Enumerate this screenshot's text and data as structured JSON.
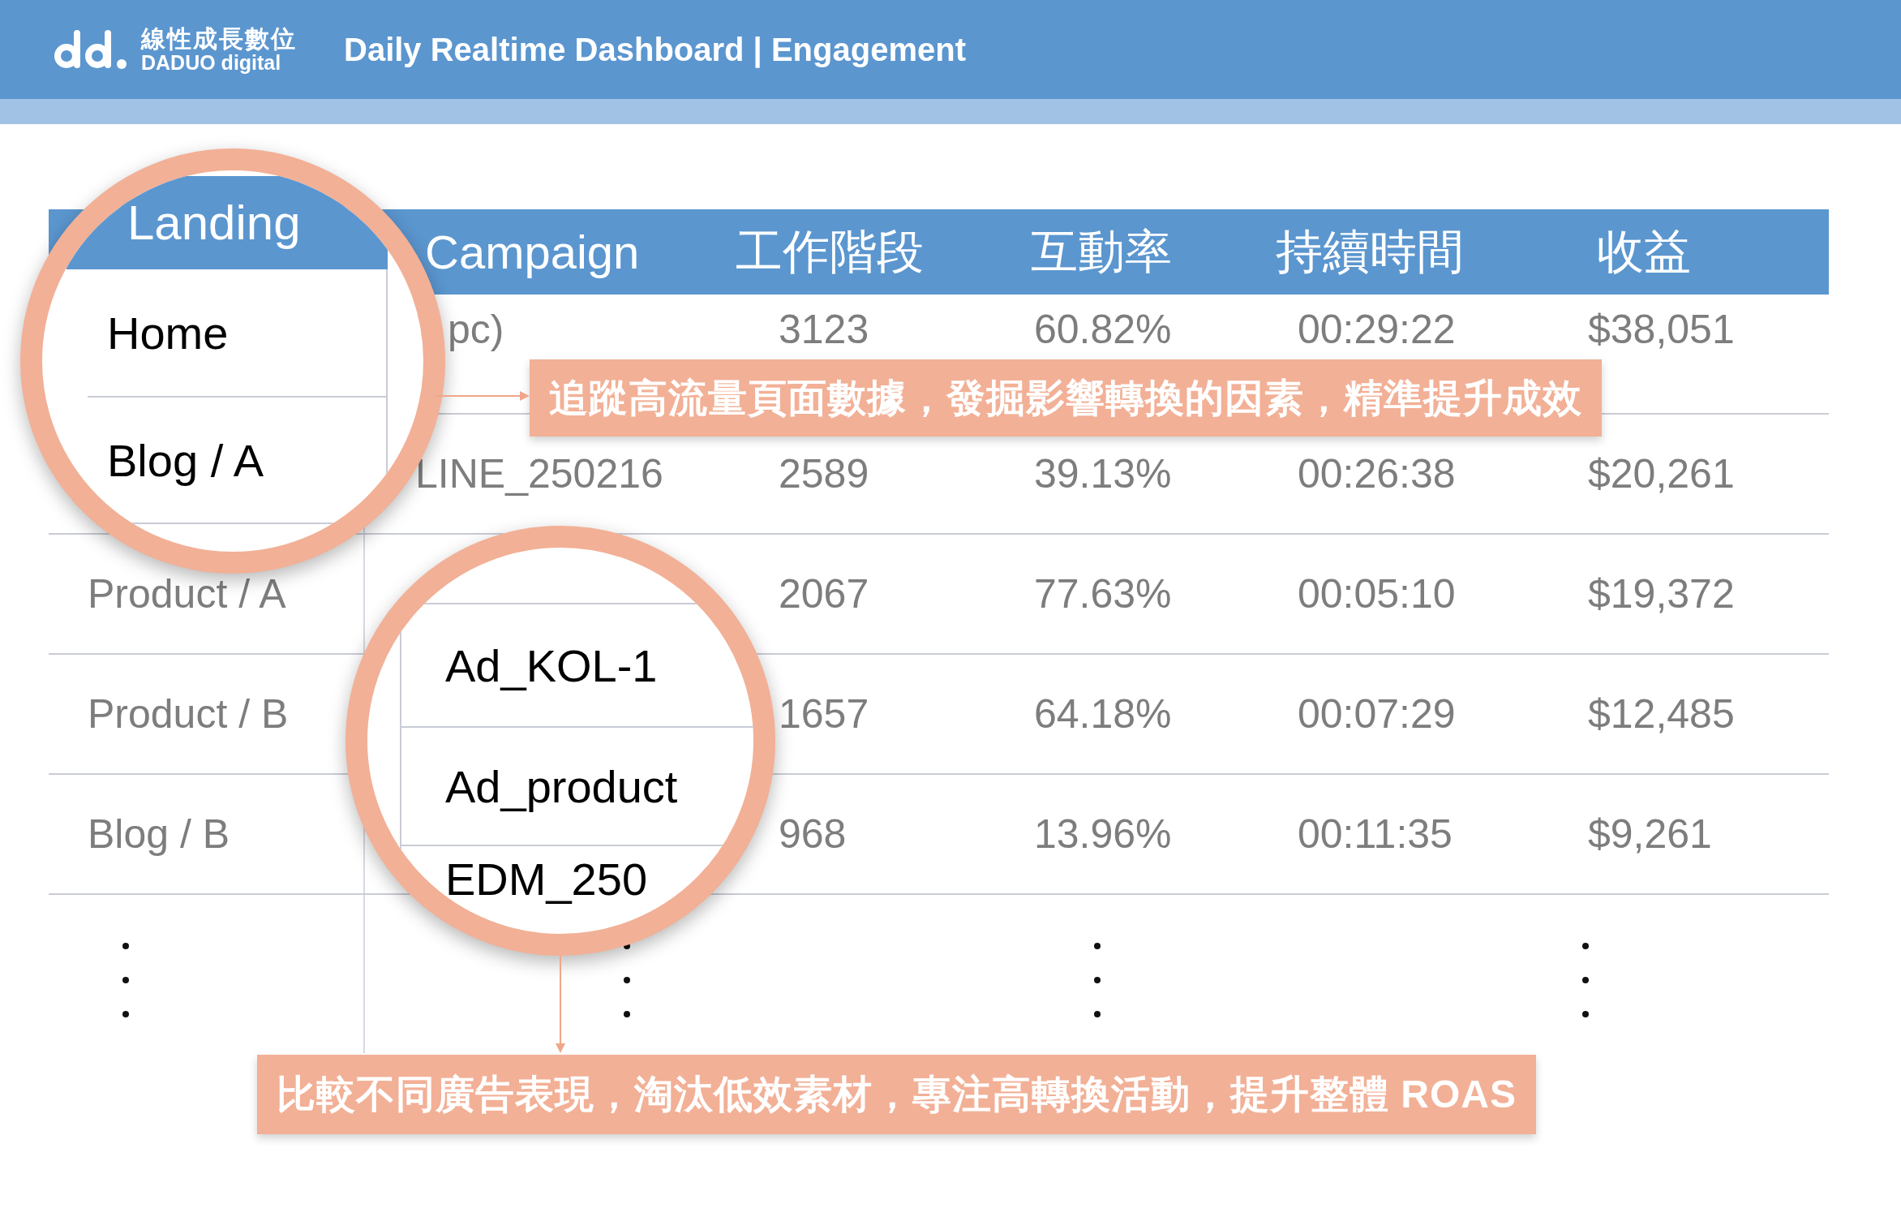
{
  "header": {
    "logo_name": "線性成長數位",
    "logo_subtitle": "DADUO digital",
    "title": "Daily Realtime Dashboard | Engagement"
  },
  "table": {
    "columns": [
      "Campaign",
      "工作階段",
      "互動率",
      "持續時間",
      "收益"
    ],
    "rows": [
      {
        "campaign": "pc)",
        "sessions": "3123",
        "engagement_rate": "60.82%",
        "duration": "00:29:22",
        "revenue": "$38,051"
      },
      {
        "campaign": "LINE_250216",
        "sessions": "2589",
        "engagement_rate": "39.13%",
        "duration": "00:26:38",
        "revenue": "$20,261"
      },
      {
        "landing": "Product / A",
        "sessions": "2067",
        "engagement_rate": "77.63%",
        "duration": "00:05:10",
        "revenue": "$19,372"
      },
      {
        "landing": "Product / B",
        "sessions": "1657",
        "engagement_rate": "64.18%",
        "duration": "00:07:29",
        "revenue": "$12,485"
      },
      {
        "landing": "Blog / B",
        "sessions": "968",
        "engagement_rate": "13.96%",
        "duration": "00:11:35",
        "revenue": "$9,261"
      }
    ]
  },
  "magnifiers": [
    {
      "header": "Landing",
      "rows": [
        "Home",
        "Blog / A"
      ]
    },
    {
      "rows": [
        "Ad_KOL-1",
        "Ad_product",
        "EDM_250"
      ]
    }
  ],
  "callouts": [
    "追蹤高流量頁面數據，發掘影響轉換的因素，精準提升成效",
    "比較不同廣告表現，淘汰低效素材，專注高轉換活動，提升整體 ROAS"
  ]
}
